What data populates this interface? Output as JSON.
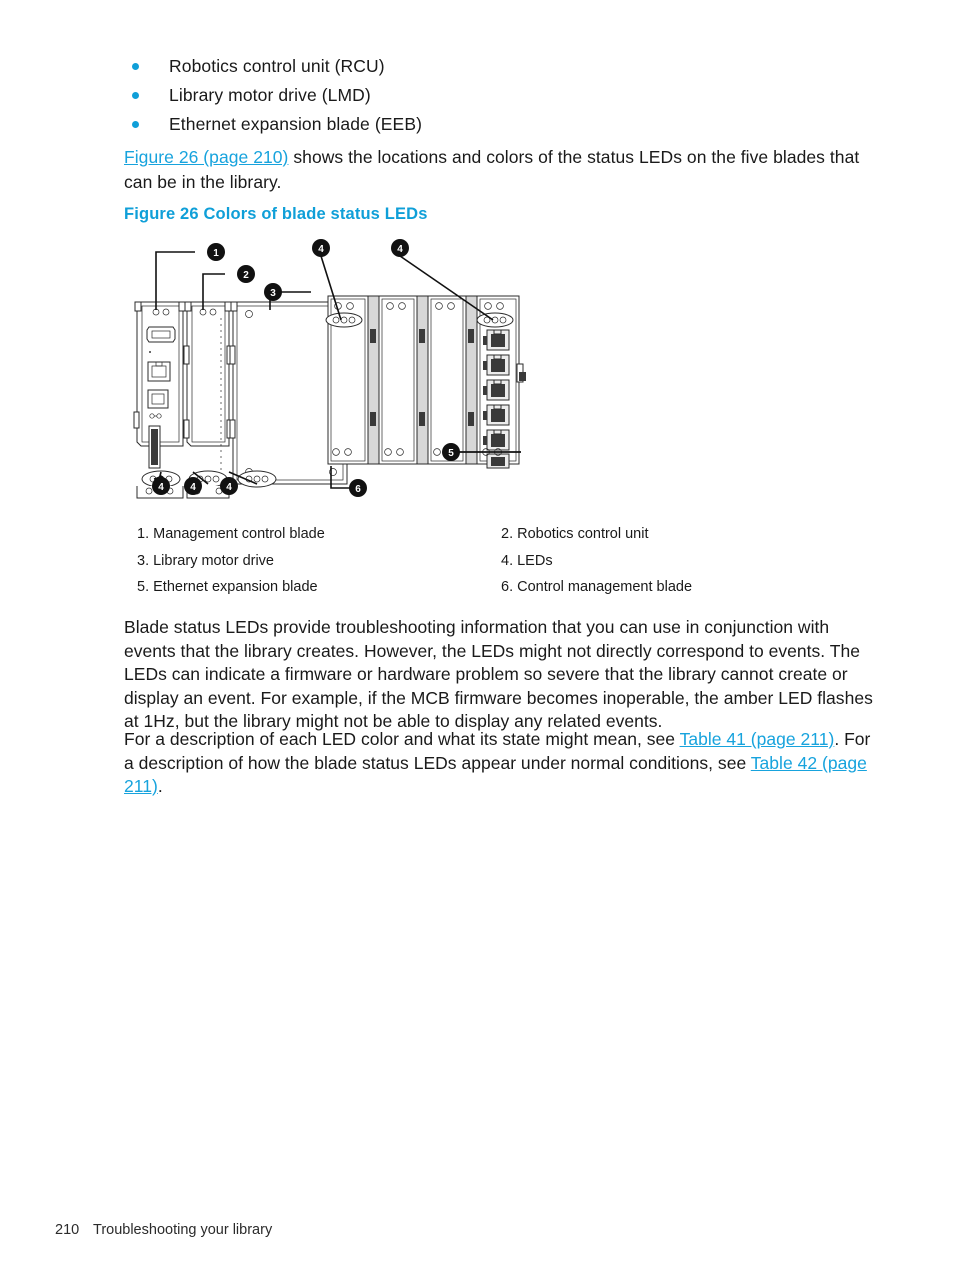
{
  "bullets": [
    {
      "label": "Robotics control unit (RCU)"
    },
    {
      "label": "Library motor drive (LMD)"
    },
    {
      "label": "Ethernet expansion blade (EEB)"
    }
  ],
  "intro": {
    "link_text": "Figure 26 (page 210)",
    "rest": " shows the locations and colors of the status LEDs on the five blades that can be in the library."
  },
  "figure": {
    "title": "Figure 26 Colors of blade status LEDs",
    "callouts": [
      {
        "number": "1"
      },
      {
        "number": "2"
      },
      {
        "number": "3"
      },
      {
        "number": "4"
      },
      {
        "number": "4"
      },
      {
        "number": "4"
      },
      {
        "number": "4"
      },
      {
        "number": "4"
      },
      {
        "number": "5"
      },
      {
        "number": "6"
      }
    ]
  },
  "legend": [
    {
      "left": "1. Management control blade",
      "right": "2. Robotics control unit"
    },
    {
      "left": "3. Library motor drive",
      "right": "4. LEDs"
    },
    {
      "left": "5. Ethernet expansion blade",
      "right": "6. Control management blade"
    }
  ],
  "paragraphs": {
    "blade_status": "Blade status LEDs provide troubleshooting information that you can use in conjunction with events that the library creates. However, the LEDs might not directly correspond to events. The LEDs can indicate a firmware or hardware problem so severe that the library cannot create or display an event. For example, if the MCB firmware becomes inoperable, the amber LED flashes at 1Hz, but the library might not be able to display any related events.",
    "description_pre": "For a description of each LED color and what its state might mean, see ",
    "description_link1": "Table 41 (page 211)",
    "description_mid": ". For a description of how the blade status LEDs appear under normal conditions, see ",
    "description_link2": "Table 42 (page 211)",
    "description_post": "."
  },
  "footer": {
    "page_number": "210",
    "chapter": "Troubleshooting your library"
  },
  "colors": {
    "link": "#17a3dd",
    "heading": "#0f9fd8",
    "bullet": "#0f9fd8",
    "text": "#1a1a1a",
    "callout_fill": "#111111"
  }
}
